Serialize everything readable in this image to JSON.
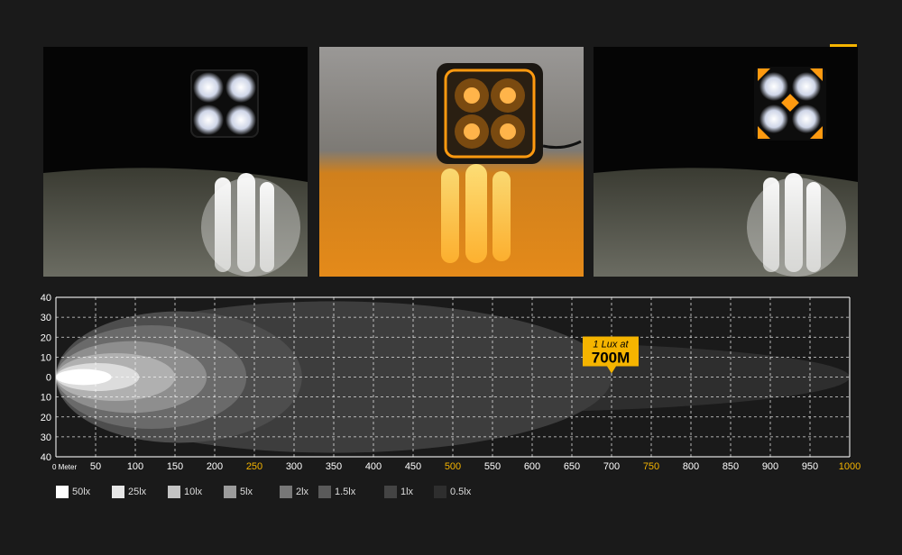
{
  "photos": [
    {
      "name": "white-mode",
      "beam_color": "#ffffff"
    },
    {
      "name": "amber-mode",
      "beam_color": "#ff9a10"
    },
    {
      "name": "white-amber-mode",
      "beam_color": "#ffffff"
    }
  ],
  "callout": {
    "line1": "1 Lux at",
    "line2": "700M",
    "color": "#f5b400"
  },
  "colors": {
    "accent": "#f5b400",
    "grid": "#ffffff",
    "background": "#1a1a1a"
  },
  "chart_data": {
    "type": "area",
    "x_ticks": [
      "0",
      "50",
      "100",
      "150",
      "200",
      "250",
      "300",
      "350",
      "400",
      "450",
      "500",
      "550",
      "600",
      "650",
      "700",
      "750",
      "800",
      "850",
      "900",
      "950",
      "1000"
    ],
    "x_first_label": "0 Meter",
    "highlight_x_ticks": [
      "250",
      "500",
      "750",
      "1000"
    ],
    "y_ticks": [
      "40",
      "30",
      "20",
      "10",
      "0",
      "10",
      "20",
      "30",
      "40"
    ],
    "xlim": [
      0,
      1000
    ],
    "ylim": [
      -40,
      40
    ],
    "grid": true,
    "series": [
      {
        "name": "0.5lx",
        "reach": 1000,
        "half_width": 18,
        "color": "#2e2e2e"
      },
      {
        "name": "1lx",
        "reach": 700,
        "half_width": 38,
        "color": "#3d3d3d"
      },
      {
        "name": "1.5lx",
        "reach": 310,
        "half_width": 33,
        "color": "#4d4d4d"
      },
      {
        "name": "2lx",
        "reach": 240,
        "half_width": 26,
        "color": "#6a6a6a"
      },
      {
        "name": "5lx",
        "reach": 190,
        "half_width": 18,
        "color": "#8e8e8e"
      },
      {
        "name": "10lx",
        "reach": 150,
        "half_width": 12,
        "color": "#b0b0b0"
      },
      {
        "name": "25lx",
        "reach": 105,
        "half_width": 7,
        "color": "#dcdcdc"
      },
      {
        "name": "50lx",
        "reach": 70,
        "half_width": 4,
        "color": "#ffffff"
      }
    ],
    "legend": [
      {
        "label": "50lx",
        "color": "#ffffff"
      },
      {
        "label": "25lx",
        "color": "#e6e6e6"
      },
      {
        "label": "10lx",
        "color": "#c4c4c4"
      },
      {
        "label": "5lx",
        "color": "#9c9c9c"
      },
      {
        "label": "2lx",
        "color": "#777777"
      },
      {
        "label": "1.5lx",
        "color": "#5a5a5a"
      },
      {
        "label": "1lx",
        "color": "#444444"
      },
      {
        "label": "0.5lx",
        "color": "#2e2e2e"
      }
    ]
  }
}
